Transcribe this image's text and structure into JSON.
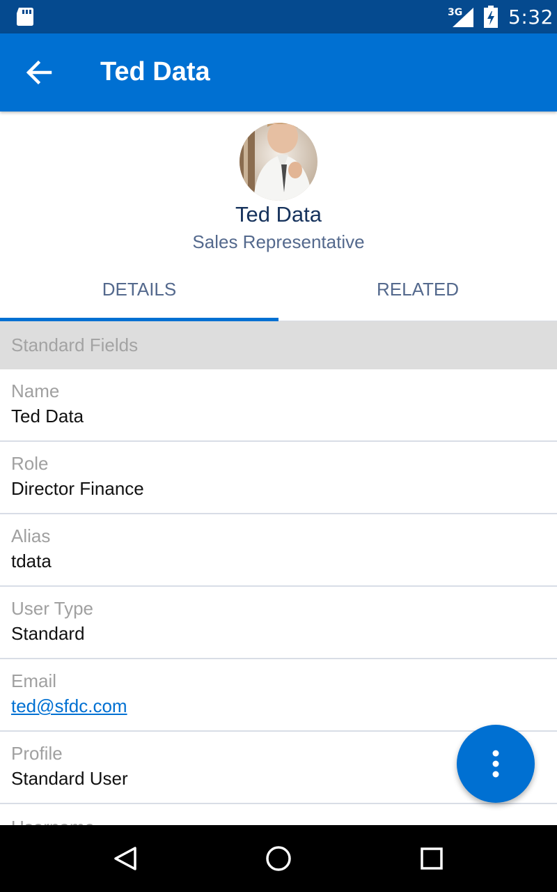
{
  "status_bar": {
    "network": "3G",
    "time": "5:32",
    "icons": [
      "sd-card-icon",
      "signal-icon",
      "battery-charging-icon"
    ]
  },
  "app_bar": {
    "title": "Ted Data",
    "back_icon": "arrow-left-icon"
  },
  "profile": {
    "name": "Ted Data",
    "title": "Sales Representative"
  },
  "tabs": [
    {
      "label": "DETAILS",
      "selected": true
    },
    {
      "label": "RELATED",
      "selected": false
    }
  ],
  "section": {
    "title": "Standard Fields"
  },
  "fields": [
    {
      "label": "Name",
      "value": "Ted Data"
    },
    {
      "label": "Role",
      "value": "Director Finance"
    },
    {
      "label": "Alias",
      "value": "tdata"
    },
    {
      "label": "User Type",
      "value": "Standard"
    },
    {
      "label": "Email",
      "value": "ted@sfdc.com"
    },
    {
      "label": "Profile",
      "value": "Standard User"
    },
    {
      "label": "Username"
    }
  ],
  "fab": {
    "icon": "more-vertical-icon"
  },
  "nav_bar": {
    "icons": [
      "nav-back-icon",
      "nav-home-icon",
      "nav-recents-icon"
    ]
  },
  "colors": {
    "status_bar": "#054a8f",
    "accent": "#0070d2",
    "section_bg": "#dddddd"
  }
}
